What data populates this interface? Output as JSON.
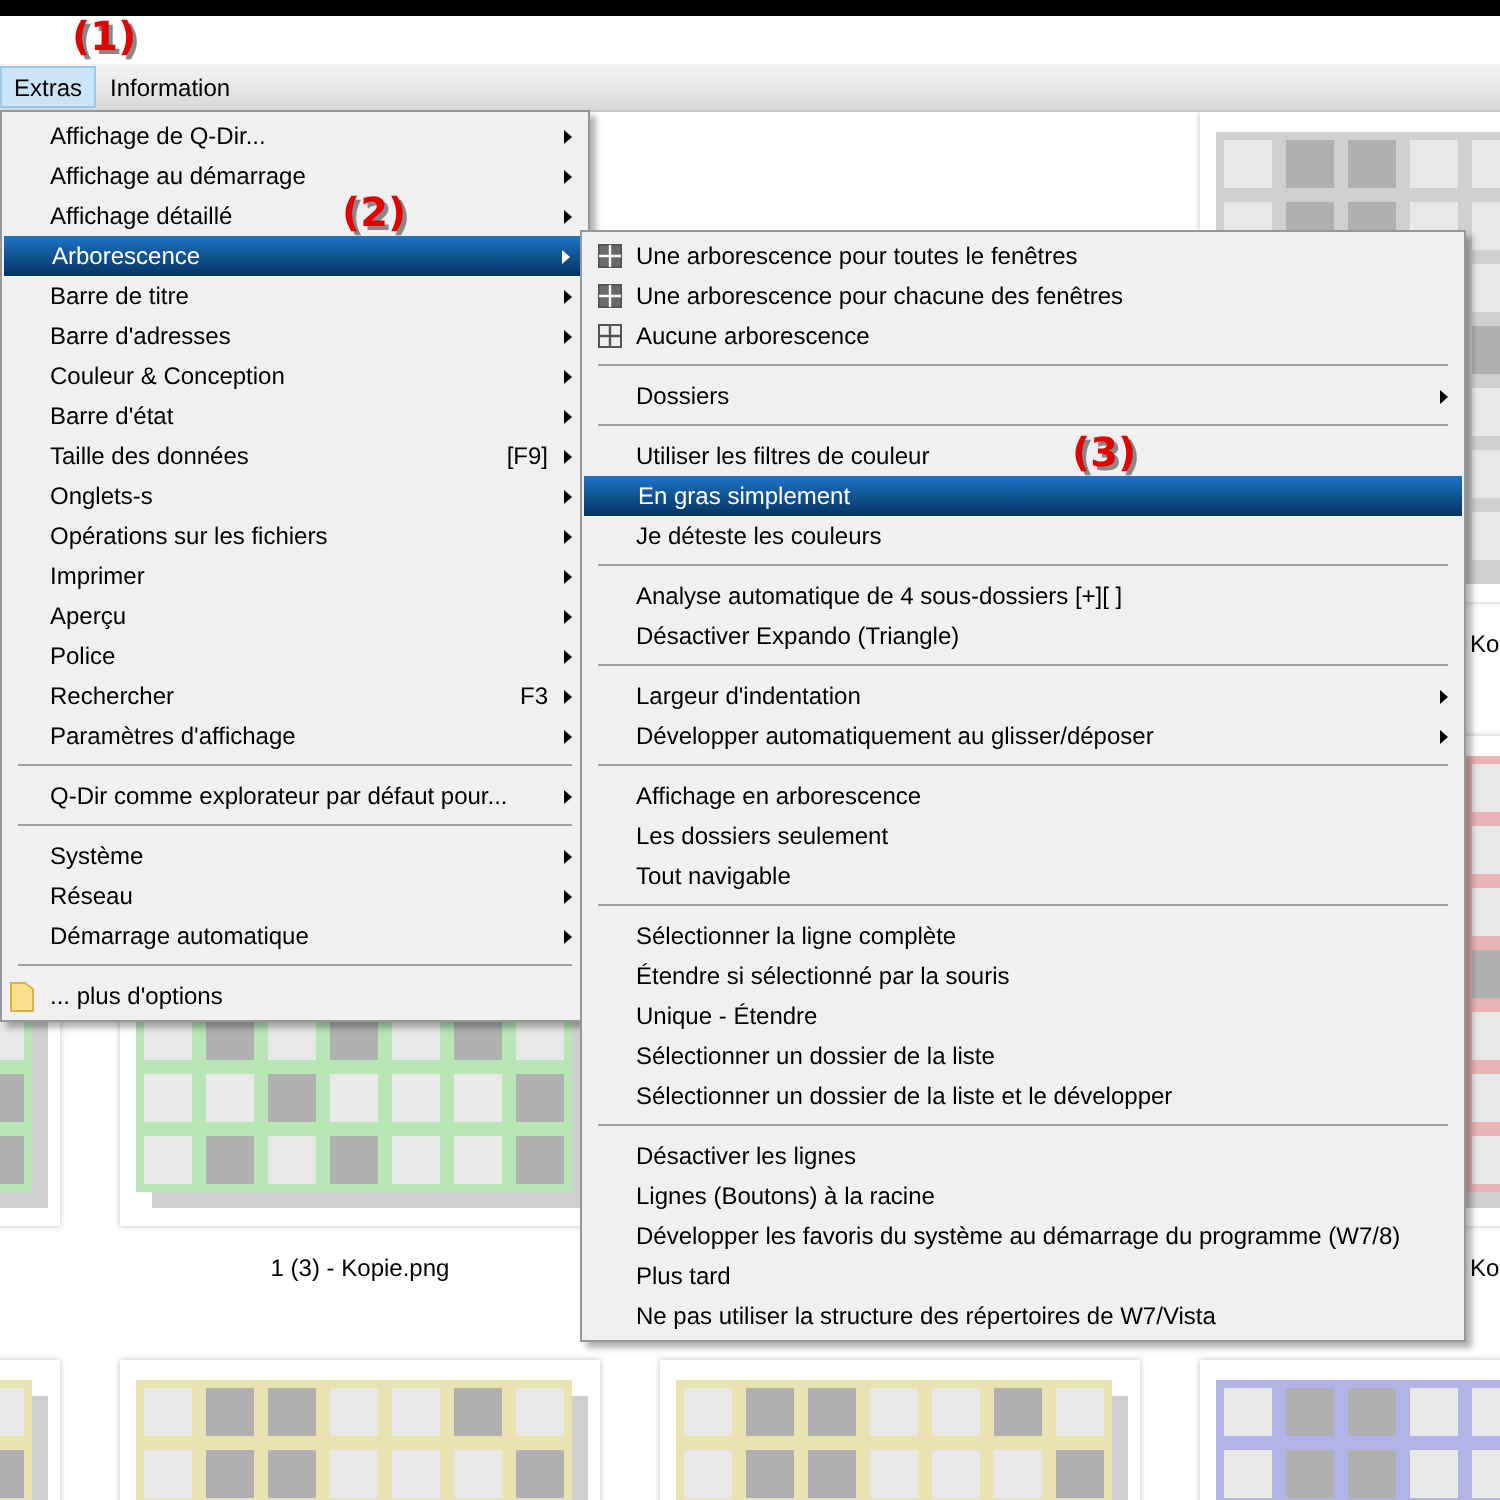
{
  "menubar": [
    {
      "label": "Extras",
      "selected": true
    },
    {
      "label": "Information",
      "selected": false
    }
  ],
  "callouts": [
    "(1)",
    "(2)",
    "(3)"
  ],
  "menu": {
    "items": [
      {
        "kind": "item",
        "label": "Affichage de Q-Dir...",
        "submenu": true,
        "selected": false
      },
      {
        "kind": "item",
        "label": "Affichage au démarrage",
        "submenu": true,
        "selected": false
      },
      {
        "kind": "item",
        "label": "Affichage détaillé",
        "submenu": true,
        "selected": false
      },
      {
        "kind": "item",
        "label": "Arborescence",
        "submenu": true,
        "selected": true
      },
      {
        "kind": "item",
        "label": "Barre de titre",
        "submenu": true,
        "selected": false
      },
      {
        "kind": "item",
        "label": "Barre d'adresses",
        "submenu": true,
        "selected": false
      },
      {
        "kind": "item",
        "label": "Couleur & Conception",
        "submenu": true,
        "selected": false
      },
      {
        "kind": "item",
        "label": "Barre d'état",
        "submenu": true,
        "selected": false
      },
      {
        "kind": "item",
        "label": "Taille des données",
        "shortcut": "[F9]",
        "submenu": true,
        "selected": false
      },
      {
        "kind": "item",
        "label": "Onglets-s",
        "submenu": true,
        "selected": false
      },
      {
        "kind": "item",
        "label": "Opérations sur les fichiers",
        "submenu": true,
        "selected": false
      },
      {
        "kind": "item",
        "label": "Imprimer",
        "submenu": true,
        "selected": false
      },
      {
        "kind": "item",
        "label": "Aperçu",
        "submenu": true,
        "selected": false
      },
      {
        "kind": "item",
        "label": "Police",
        "submenu": true,
        "selected": false
      },
      {
        "kind": "item",
        "label": "Rechercher",
        "shortcut": "F3",
        "submenu": true,
        "selected": false
      },
      {
        "kind": "item",
        "label": "Paramètres d'affichage",
        "submenu": true,
        "selected": false
      },
      {
        "kind": "separator"
      },
      {
        "kind": "item",
        "label": "Q-Dir comme explorateur par défaut pour...",
        "submenu": true,
        "selected": false
      },
      {
        "kind": "separator"
      },
      {
        "kind": "item",
        "label": "Système",
        "submenu": true,
        "selected": false
      },
      {
        "kind": "item",
        "label": "Réseau",
        "submenu": true,
        "selected": false
      },
      {
        "kind": "item",
        "label": "Démarrage automatique",
        "submenu": true,
        "selected": false
      },
      {
        "kind": "separator"
      },
      {
        "kind": "folder",
        "label": "... plus d'options",
        "submenu": false,
        "selected": false
      }
    ]
  },
  "submenu": {
    "items": [
      {
        "kind": "layout",
        "label": "Une arborescence pour toutes le fenêtres",
        "checked": true,
        "submenu": false,
        "selected": false
      },
      {
        "kind": "layout",
        "label": "Une arborescence pour chacune des fenêtres",
        "checked": true,
        "submenu": false,
        "selected": false
      },
      {
        "kind": "layout",
        "label": "Aucune arborescence",
        "checked": false,
        "submenu": false,
        "selected": false
      },
      {
        "kind": "separator"
      },
      {
        "kind": "item",
        "label": "Dossiers",
        "submenu": true,
        "selected": false
      },
      {
        "kind": "separator"
      },
      {
        "kind": "item",
        "label": "Utiliser les filtres de couleur",
        "submenu": false,
        "selected": false
      },
      {
        "kind": "item",
        "label": "En gras simplement",
        "submenu": false,
        "selected": true
      },
      {
        "kind": "item",
        "label": "Je déteste les couleurs",
        "submenu": false,
        "selected": false
      },
      {
        "kind": "separator"
      },
      {
        "kind": "item",
        "label": "Analyse automatique de 4 sous-dossiers [+][ ]",
        "submenu": false,
        "selected": false
      },
      {
        "kind": "item",
        "label": "Désactiver Expando (Triangle)",
        "submenu": false,
        "selected": false
      },
      {
        "kind": "separator"
      },
      {
        "kind": "item",
        "label": "Largeur d'indentation",
        "submenu": true,
        "selected": false
      },
      {
        "kind": "item",
        "label": "Développer automatiquement au glisser/déposer",
        "submenu": true,
        "selected": false
      },
      {
        "kind": "separator"
      },
      {
        "kind": "item",
        "label": "Affichage en arborescence",
        "submenu": false,
        "selected": false
      },
      {
        "kind": "item",
        "label": "Les dossiers seulement",
        "submenu": false,
        "selected": false
      },
      {
        "kind": "item",
        "label": "Tout navigable",
        "submenu": false,
        "selected": false
      },
      {
        "kind": "separator"
      },
      {
        "kind": "item",
        "label": "Sélectionner la ligne complète",
        "submenu": false,
        "selected": false
      },
      {
        "kind": "item",
        "label": "Étendre si sélectionné par la souris",
        "submenu": false,
        "selected": false
      },
      {
        "kind": "item",
        "label": "Unique - Étendre",
        "submenu": false,
        "selected": false
      },
      {
        "kind": "item",
        "label": "Sélectionner un dossier de la liste",
        "submenu": false,
        "selected": false
      },
      {
        "kind": "item",
        "label": "Sélectionner un dossier de la liste et le développer",
        "submenu": false,
        "selected": false
      },
      {
        "kind": "separator"
      },
      {
        "kind": "item",
        "label": "Désactiver les lignes",
        "submenu": false,
        "selected": false
      },
      {
        "kind": "item",
        "label": "Lignes (Boutons) à la racine",
        "submenu": false,
        "selected": false
      },
      {
        "kind": "item",
        "label": "Développer les favoris du système au démarrage du programme (W7/8)",
        "submenu": false,
        "selected": false
      },
      {
        "kind": "item",
        "label": "Plus tard",
        "submenu": false,
        "selected": false
      },
      {
        "kind": "item",
        "label": "Ne pas utiliser la structure des répertoires de W7/Vista",
        "submenu": false,
        "selected": false
      }
    ]
  },
  "thumbnails": [
    {
      "column_4": {
        "color": "#d0d0d0",
        "label": "Ko"
      }
    },
    {
      "column_1": {
        "color": "#b9e6b5"
      },
      "column_2": {
        "color": "#b9e6b5",
        "label": "1 (3) - Kopie.png"
      },
      "column_4": {
        "color": "#e8b4b4",
        "label": "Ko"
      }
    },
    {
      "column_1": {
        "color": "#e9e2b2"
      },
      "column_2": {
        "color": "#e9e2b2"
      },
      "column_3": {
        "color": "#e9e2b2"
      },
      "column_4": {
        "color": "#b3b3e8"
      }
    }
  ]
}
